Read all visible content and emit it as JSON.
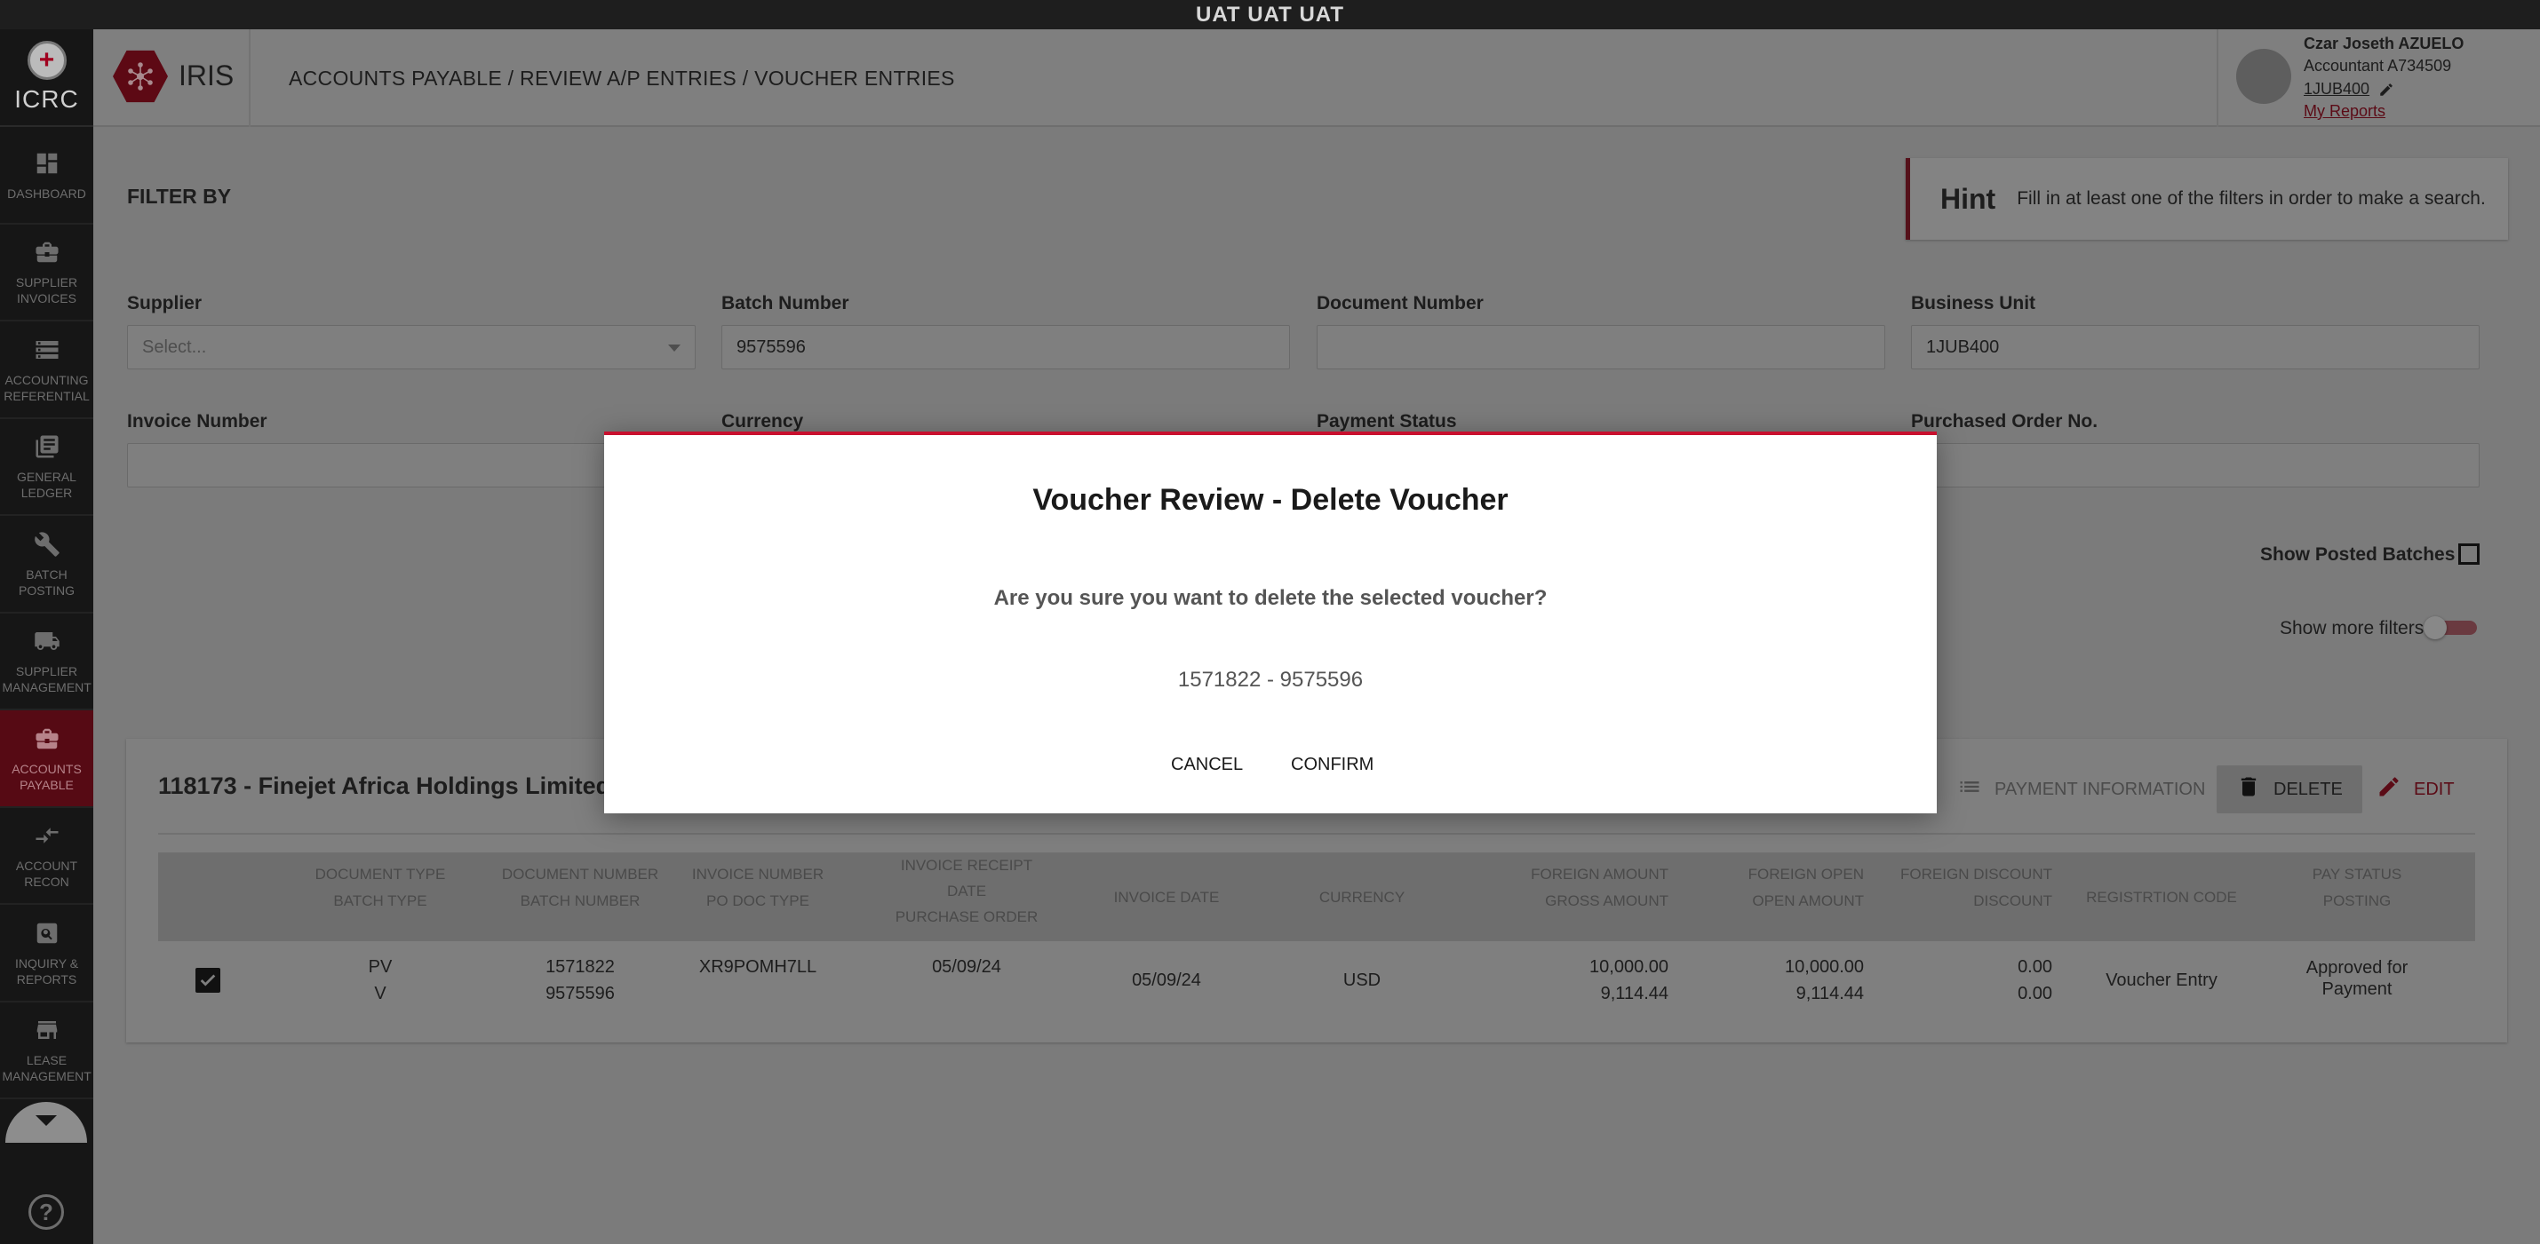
{
  "env_banner": "UAT UAT UAT",
  "org": {
    "name": "ICRC"
  },
  "sidebar": {
    "items": [
      {
        "label": "DASHBOARD",
        "icon": "dashboard-icon",
        "active": false
      },
      {
        "label": "SUPPLIER INVOICES",
        "icon": "briefcase-icon",
        "active": false
      },
      {
        "label": "ACCOUNTING REFERENTIAL",
        "icon": "storage-icon",
        "active": false
      },
      {
        "label": "GENERAL LEDGER",
        "icon": "ledger-icon",
        "active": false
      },
      {
        "label": "BATCH POSTING",
        "icon": "wrench-icon",
        "active": false
      },
      {
        "label": "SUPPLIER MANAGEMENT",
        "icon": "truck-icon",
        "active": false
      },
      {
        "label": "ACCOUNTS PAYABLE",
        "icon": "briefcase-icon",
        "active": true
      },
      {
        "label": "ACCOUNT RECON",
        "icon": "compare-arrows-icon",
        "active": false
      },
      {
        "label": "INQUIRY & REPORTS",
        "icon": "search-report-icon",
        "active": false
      },
      {
        "label": "LEASE MANAGEMENT",
        "icon": "store-icon",
        "active": false
      }
    ],
    "more_icon": "chevron-down-icon",
    "help_label": "?"
  },
  "header": {
    "app_name": "IRIS",
    "breadcrumb": "ACCOUNTS PAYABLE / REVIEW A/P ENTRIES / VOUCHER ENTRIES",
    "user": {
      "name": "Czar Joseth AZUELO",
      "role": "Accountant A734509",
      "business_unit": "1JUB400",
      "reports_link": "My Reports"
    }
  },
  "filters": {
    "title": "FILTER BY",
    "hint": {
      "title": "Hint",
      "text": "Fill in at least one of the filters in order to make a search."
    },
    "supplier": {
      "label": "Supplier",
      "placeholder": "Select...",
      "value": ""
    },
    "batch_number": {
      "label": "Batch Number",
      "value": "9575596"
    },
    "document_number": {
      "label": "Document Number",
      "value": ""
    },
    "business_unit": {
      "label": "Business Unit",
      "value": "1JUB400"
    },
    "invoice_number": {
      "label": "Invoice Number",
      "value": ""
    },
    "currency": {
      "label": "Currency",
      "value": ""
    },
    "payment_status": {
      "label": "Payment Status",
      "value": ""
    },
    "purchase_order": {
      "label": "Purchased Order No.",
      "value": ""
    },
    "show_posted_batches": {
      "label": "Show Posted Batches",
      "checked": false
    },
    "show_more_filters": {
      "label": "Show more filters",
      "on": false
    }
  },
  "batch": {
    "title": "118173 - Finejet Africa Holdings Limited",
    "actions": {
      "payment_information": "PAYMENT INFORMATION",
      "delete": "DELETE",
      "edit": "EDIT"
    },
    "columns": [
      {
        "top": "DOCUMENT TYPE",
        "bottom": "BATCH TYPE"
      },
      {
        "top": "DOCUMENT NUMBER",
        "bottom": "BATCH NUMBER"
      },
      {
        "top": "INVOICE NUMBER",
        "bottom": "PO DOC TYPE"
      },
      {
        "top": "INVOICE RECEIPT",
        "middle": "DATE",
        "bottom": "PURCHASE ORDER"
      },
      {
        "top": "INVOICE DATE"
      },
      {
        "top": "CURRENCY"
      },
      {
        "top": "FOREIGN AMOUNT",
        "bottom": "GROSS AMOUNT"
      },
      {
        "top": "FOREIGN OPEN",
        "bottom": "OPEN AMOUNT"
      },
      {
        "top": "FOREIGN DISCOUNT",
        "bottom": "DISCOUNT"
      },
      {
        "top": "REGISTRTION CODE"
      },
      {
        "top": "PAY STATUS",
        "bottom": "POSTING"
      }
    ],
    "rows": [
      {
        "selected": true,
        "document_type": "PV",
        "batch_type": "V",
        "document_number": "1571822",
        "batch_number": "9575596",
        "invoice_number": "XR9POMH7LL",
        "invoice_receipt_date": "05/09/24",
        "invoice_date": "05/09/24",
        "currency": "USD",
        "foreign_amount": "10,000.00",
        "gross_amount": "9,114.44",
        "foreign_open": "10,000.00",
        "open_amount": "9,114.44",
        "foreign_discount": "0.00",
        "discount": "0.00",
        "registration_code": "Voucher Entry",
        "pay_status_line1": "Approved for",
        "pay_status_line2": "Payment"
      }
    ]
  },
  "modal": {
    "title": "Voucher Review - Delete Voucher",
    "question": "Are you sure you want to delete the selected voucher?",
    "reference": "1571822 - 9575596",
    "cancel_label": "CANCEL",
    "confirm_label": "CONFIRM",
    "accent_color": "#c8102e"
  }
}
